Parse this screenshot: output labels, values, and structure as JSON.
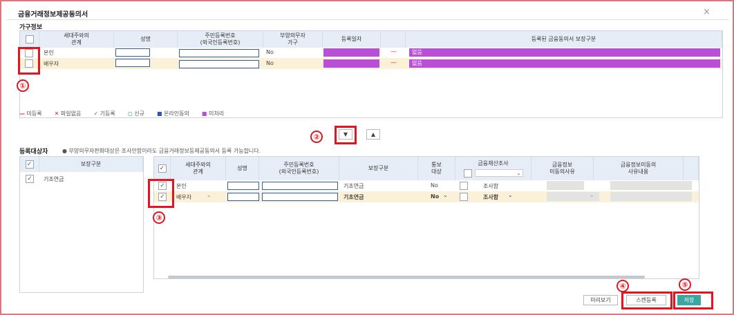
{
  "dialog": {
    "title": "금융거래정보제공동의서",
    "close": "×"
  },
  "family": {
    "section": "가구정보",
    "headers": [
      "세대주와의\n관계",
      "성명",
      "주민등록번호\n(외국인등록번호)",
      "부양의무자\n가구",
      "등록일자",
      "등록된 금융동의서 보장구분"
    ],
    "rows": [
      {
        "rel": "본인",
        "duty": "No",
        "dash": "—",
        "status": "없음"
      },
      {
        "rel": "배우자",
        "duty": "No",
        "dash": "—",
        "status": "없음"
      }
    ]
  },
  "legend": [
    {
      "sym": "—",
      "label": "미등록"
    },
    {
      "sym": "✕",
      "label": "파일없음"
    },
    {
      "sym": "✓",
      "label": "기등록"
    },
    {
      "sym": "○",
      "label": "신규"
    },
    {
      "sym": "■",
      "label": "온라인동의"
    },
    {
      "sym": "■",
      "label": "미처리"
    }
  ],
  "target": {
    "section": "등록대상자",
    "note": "● 부양의무자판화대상은 조사안함이라도 금융거래정보등제공동의서 등록 가능합니다.",
    "left_header": "보장구분",
    "left_item": "기초연금",
    "headers": [
      "세대주와의\n관계",
      "성명",
      "주민등록번호\n(외국인등록번호)",
      "보장구분",
      "통보\n대상",
      "금융재산조사",
      "금융정보\n미동의사유",
      "금융정보미동의\n사유내용"
    ],
    "rows": [
      {
        "rel": "본인",
        "type": "기초연금",
        "notify": "No",
        "survey": "조사함"
      },
      {
        "rel": "배우자",
        "type": "기초연금",
        "notify": "No",
        "survey": "조사함"
      }
    ]
  },
  "markers": [
    "①",
    "②",
    "③",
    "④",
    "⑤"
  ],
  "buttons": {
    "preview": "미리보기",
    "scan": "스캔등록",
    "save": "저장"
  },
  "colors": {
    "purple": "#b94fd6",
    "highlight": "#e3141d",
    "header": "#e6edf6"
  }
}
